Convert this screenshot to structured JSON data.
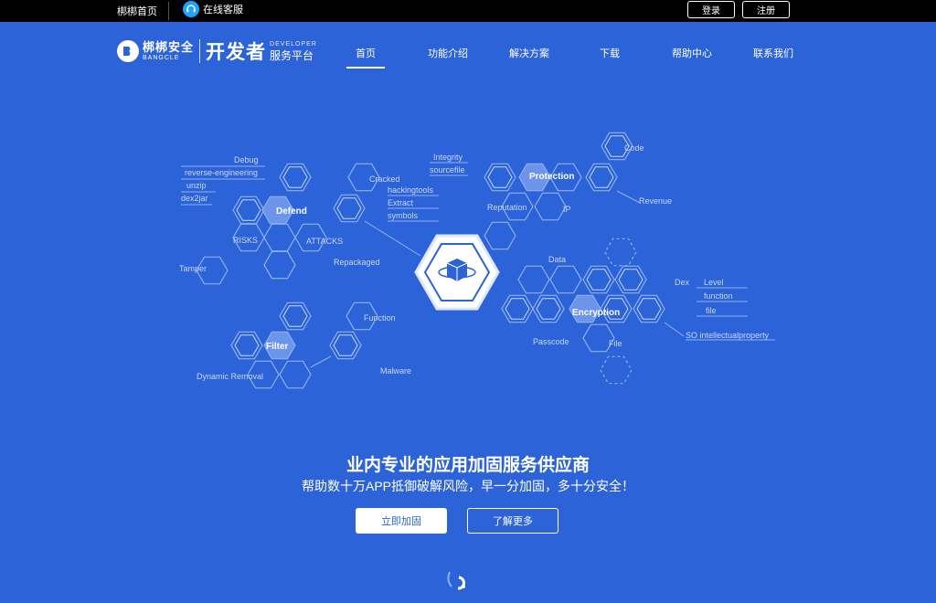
{
  "topbar": {
    "home_link": "梆梆首页",
    "online_service": "在线客服",
    "login": "登录",
    "register": "注册"
  },
  "logo": {
    "brand_cn": "梆梆安全",
    "brand_en": "BANGCLE",
    "developer": "开发者",
    "developer_en": "DEVELOPER",
    "platform": "服务平台"
  },
  "nav": {
    "items": [
      "首页",
      "功能介绍",
      "解决方案",
      "下载",
      "帮助中心",
      "联系我们"
    ],
    "active": "首页"
  },
  "hero": {
    "defend": "Defend",
    "protection": "Protection",
    "encryption": "Encryption",
    "filter": "Filter",
    "labels": {
      "debug": "Debug",
      "reverse_engineering": "reverse-engineering",
      "unzip": "unzip",
      "dex2jar": "dex2jar",
      "risks": "RISKS",
      "attacks": "ATTACKS",
      "tamper": "Tamper",
      "cracked": "Cracked",
      "hackingtools": "hackingtools",
      "extract": "Extract",
      "symbols": "symbols",
      "repackaged": "Repackaged",
      "integrity": "Integrity",
      "sourcefile": "sourcefile",
      "reputation": "Reputation",
      "ip": "IP",
      "code": "Code",
      "revenue": "Revenue",
      "data": "Data",
      "dex": "Dex",
      "level": "Level",
      "function_lc": "function",
      "file_lc": "file",
      "so_ip": "SO intellectualproperty",
      "passcode": "Passcode",
      "file": "File",
      "function": "Function",
      "malware": "Malware",
      "dynamic_removal": "Dynamic Removal"
    },
    "colors": {
      "line": "#8fb0f2",
      "hex_fill": "#6b94ea",
      "center_fill": "#ffffff",
      "center_icon": "#2d63d8"
    }
  },
  "headline": "业内专业的应用加固服务供应商",
  "subline": "帮助数十万APP抵御破解风险，早一分加固，多十分安全！",
  "cta": {
    "primary": "立即加固",
    "secondary": "了解更多"
  }
}
